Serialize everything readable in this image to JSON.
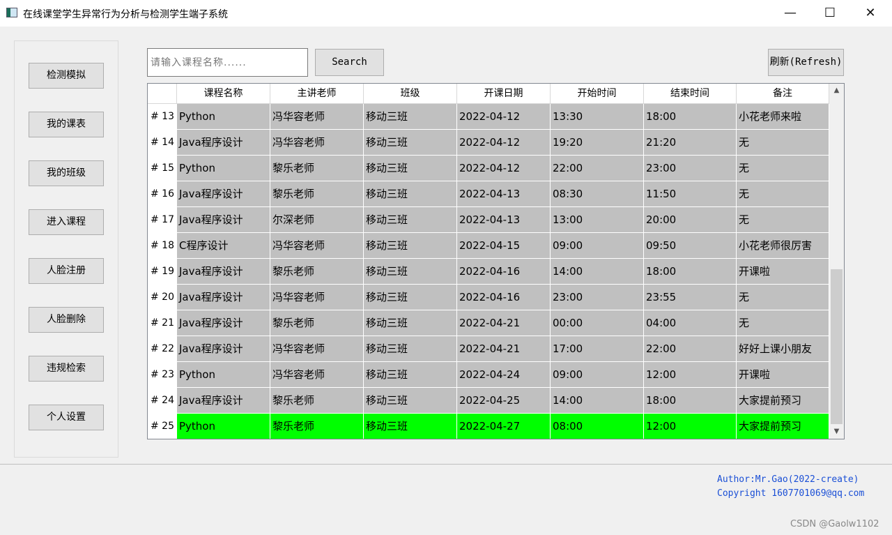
{
  "window": {
    "title": "在线课堂学生异常行为分析与检测学生端子系统",
    "minimize": "—",
    "maximize": "☐",
    "close": "✕"
  },
  "sidebar": {
    "items": [
      {
        "label": "检测模拟"
      },
      {
        "label": "我的课表"
      },
      {
        "label": "我的班级"
      },
      {
        "label": "进入课程"
      },
      {
        "label": "人脸注册"
      },
      {
        "label": "人脸删除"
      },
      {
        "label": "违规检索"
      },
      {
        "label": "个人设置"
      }
    ]
  },
  "search": {
    "placeholder": "请输入课程名称......",
    "button_label": "Search"
  },
  "refresh": {
    "label": "刷新(Refresh)"
  },
  "table": {
    "headers": [
      "课程名称",
      "主讲老师",
      "班级",
      "开课日期",
      "开始时间",
      "结束时间",
      "备注"
    ],
    "rows": [
      {
        "num": "# 13",
        "cells": [
          "Python",
          "冯华容老师",
          "移动三班",
          "2022-04-12",
          "13:30",
          "18:00",
          "小花老师来啦"
        ]
      },
      {
        "num": "# 14",
        "cells": [
          "Java程序设计",
          "冯华容老师",
          "移动三班",
          "2022-04-12",
          "19:20",
          "21:20",
          "无"
        ]
      },
      {
        "num": "# 15",
        "cells": [
          "Python",
          "黎乐老师",
          "移动三班",
          "2022-04-12",
          "22:00",
          "23:00",
          "无"
        ]
      },
      {
        "num": "# 16",
        "cells": [
          "Java程序设计",
          "黎乐老师",
          "移动三班",
          "2022-04-13",
          "08:30",
          "11:50",
          "无"
        ]
      },
      {
        "num": "# 17",
        "cells": [
          "Java程序设计",
          "尔深老师",
          "移动三班",
          "2022-04-13",
          "13:00",
          "20:00",
          "无"
        ]
      },
      {
        "num": "# 18",
        "cells": [
          "C程序设计",
          "冯华容老师",
          "移动三班",
          "2022-04-15",
          "09:00",
          "09:50",
          "小花老师很厉害"
        ]
      },
      {
        "num": "# 19",
        "cells": [
          "Java程序设计",
          "黎乐老师",
          "移动三班",
          "2022-04-16",
          "14:00",
          "18:00",
          "开课啦"
        ]
      },
      {
        "num": "# 20",
        "cells": [
          "Java程序设计",
          "冯华容老师",
          "移动三班",
          "2022-04-16",
          "23:00",
          "23:55",
          "无"
        ]
      },
      {
        "num": "# 21",
        "cells": [
          "Java程序设计",
          "黎乐老师",
          "移动三班",
          "2022-04-21",
          "00:00",
          "04:00",
          "无"
        ]
      },
      {
        "num": "# 22",
        "cells": [
          "Java程序设计",
          "冯华容老师",
          "移动三班",
          "2022-04-21",
          "17:00",
          "22:00",
          "好好上课小朋友"
        ]
      },
      {
        "num": "# 23",
        "cells": [
          "Python",
          "冯华容老师",
          "移动三班",
          "2022-04-24",
          "09:00",
          "12:00",
          "开课啦"
        ]
      },
      {
        "num": "# 24",
        "cells": [
          "Java程序设计",
          "黎乐老师",
          "移动三班",
          "2022-04-25",
          "14:00",
          "18:00",
          "大家提前预习"
        ]
      },
      {
        "num": "# 25",
        "cells": [
          "Python",
          "黎乐老师",
          "移动三班",
          "2022-04-27",
          "08:00",
          "12:00",
          "大家提前预习"
        ],
        "highlight": true
      }
    ]
  },
  "colors": {
    "row_bg": "#c0c0c0",
    "highlight_bg": "#00ff00",
    "link": "#1a4fd6"
  },
  "footer": {
    "author": "Author:Mr.Gao(2022-create)",
    "copyright": "Copyright 1607701069@qq.com"
  },
  "watermark": "CSDN @Gaolw1102"
}
